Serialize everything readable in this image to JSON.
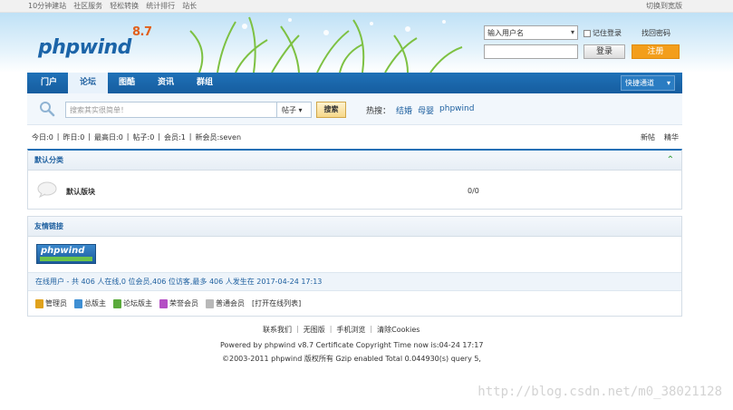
{
  "topbar": {
    "links": [
      "10分钟建站",
      "社区服务",
      "轻松转换",
      "统计排行",
      "站长"
    ],
    "right": "切换到宽版"
  },
  "header": {
    "logo_text": "phpwind",
    "logo_version": "8.7",
    "login": {
      "username_value": "输入用户名",
      "remember_label": "记住登录",
      "find_password": "找回密码",
      "login_button": "登录",
      "register_button": "注册"
    }
  },
  "nav": {
    "tabs": [
      "门户",
      "论坛",
      "图酷",
      "资讯",
      "群组"
    ],
    "active_index": 1,
    "quick": "快捷通道"
  },
  "search": {
    "placeholder": "搜索其实很简单！",
    "type": "帖子",
    "button": "搜索",
    "hot_label": "热搜：",
    "hot_terms": [
      "结婚",
      "母婴",
      "phpwind"
    ]
  },
  "stats": {
    "items": [
      "今日:0",
      "昨日:0",
      "最高日:0",
      "帖子:0",
      "会员:1",
      "新会员:seven"
    ],
    "right": [
      "新帖",
      "精华"
    ]
  },
  "category": {
    "title": "默认分类",
    "forum_name": "默认版块",
    "forum_count": "0/0"
  },
  "links_panel": {
    "title": "友情链接",
    "logo_text": "phpwind",
    "online_text": "在线用户 - 共 406 人在线,0 位会员,406 位访客,最多 406 人发生在 2017-04-24 17:13",
    "legend": [
      {
        "label": "管理员",
        "color": "#e0a21d"
      },
      {
        "label": "总版主",
        "color": "#3f8fd3"
      },
      {
        "label": "论坛版主",
        "color": "#5aaa3c"
      },
      {
        "label": "荣誉会员",
        "color": "#b44fc4"
      },
      {
        "label": "普通会员",
        "color": "#b8b8b8"
      }
    ],
    "open_list": "[打开在线列表]"
  },
  "footer": {
    "links": [
      "联系我们",
      "无图版",
      "手机浏览",
      "清除Cookies"
    ],
    "line2": "Powered by phpwind v8.7 Certificate Copyright Time now is:04-24 17:17",
    "line3": "©2003-2011 phpwind 版权所有 Gzip enabled Total 0.044930(s) query 5,",
    "watermark": "http://blog.csdn.net/m0_38021128"
  },
  "colors": {
    "brand_blue": "#1d6fb5",
    "register_orange": "#f39e1b"
  }
}
